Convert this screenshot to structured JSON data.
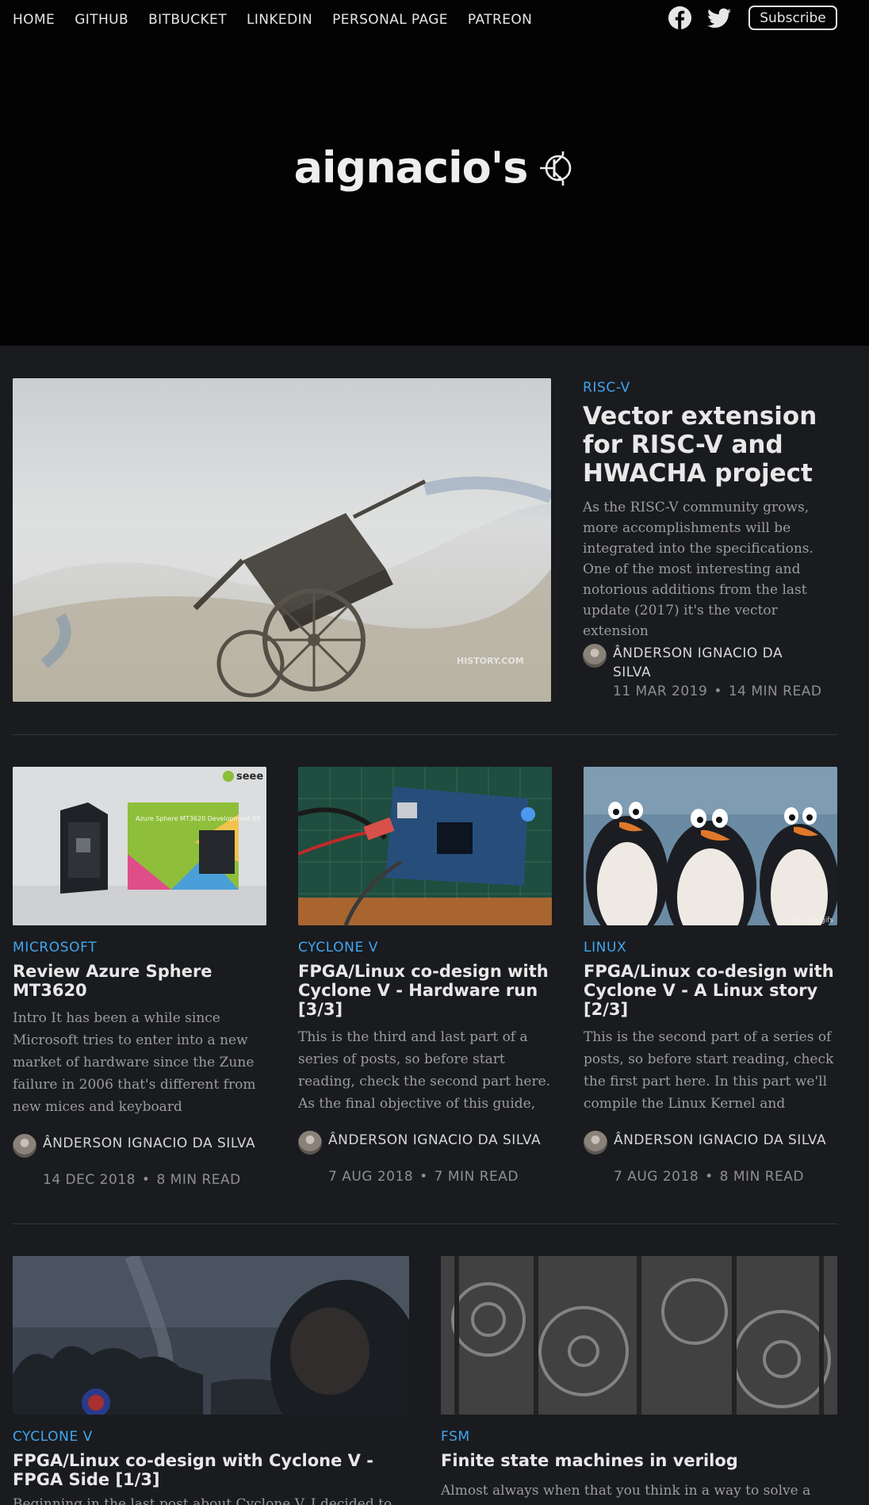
{
  "nav": {
    "items": [
      "HOME",
      "GITHUB",
      "BITBUCKET",
      "LINKEDIN",
      "PERSONAL PAGE",
      "PATREON"
    ],
    "subscribe_label": "Subscribe",
    "facebook_icon": "facebook-icon",
    "twitter_icon": "twitter-icon"
  },
  "site": {
    "title": "aignacio's",
    "logo_icon": "transistor-icon"
  },
  "colors": {
    "header_bg": "#030303",
    "page_bg": "#191b1f",
    "accent": "#42a5ee"
  },
  "featured": {
    "tag": "RISC-V",
    "title": "Vector extension for RISC-V and HWACHA project",
    "excerpt": "As the RISC-V community grows, more accomplishments will be integrated into the specifications. One of the most interesting and notorious additions from the last update (2017) it's the vector extension",
    "author": "ÂNDERSON IGNACIO DA SILVA",
    "date": "11 MAR 2019",
    "read_time": "14 MIN READ",
    "image_watermark": "HISTORY.COM"
  },
  "posts_row1": [
    {
      "tag": "MICROSOFT",
      "title": "Review Azure Sphere MT3620",
      "excerpt": "Intro It has been a while since Microsoft tries to enter into a new market of hardware since the Zune failure in 2006 that's different from new mices and keyboard",
      "author": "ÂNDERSON IGNACIO DA SILVA",
      "date": "14 DEC 2018",
      "read_time": "8 MIN READ",
      "image_text": "Azure Sphere MT3620 Development Kit",
      "image_brand": "seee"
    },
    {
      "tag": "CYCLONE V",
      "title": "FPGA/Linux co-design with Cyclone V - Hardware run [3/3]",
      "excerpt": "This is the third and last part of a series of posts, so before start reading, check the second part here. As the final objective of this guide, we'll build",
      "author": "ÂNDERSON IGNACIO DA SILVA",
      "date": "7 AUG 2018",
      "read_time": "7 MIN READ"
    },
    {
      "tag": "LINUX",
      "title": "FPGA/Linux co-design with Cyclone V - A Linux story [2/3]",
      "excerpt": "This is the second part of a series of posts, so before start reading, check the first part here. In this part we'll compile the Linux Kernel and generate a",
      "author": "ÂNDERSON IGNACIO DA SILVA",
      "date": "7 AUG 2018",
      "read_time": "8 MIN READ",
      "image_watermark": "9k.com/gifs"
    }
  ],
  "posts_row2": [
    {
      "tag": "CYCLONE V",
      "title": "FPGA/Linux co-design with Cyclone V - FPGA Side [1/3]",
      "excerpt": "Beginning in the last post about Cyclone V, I decided to"
    },
    {
      "tag": "FSM",
      "title": "Finite state machines in verilog",
      "excerpt": "Almost always when that you think in a way to solve a"
    }
  ]
}
